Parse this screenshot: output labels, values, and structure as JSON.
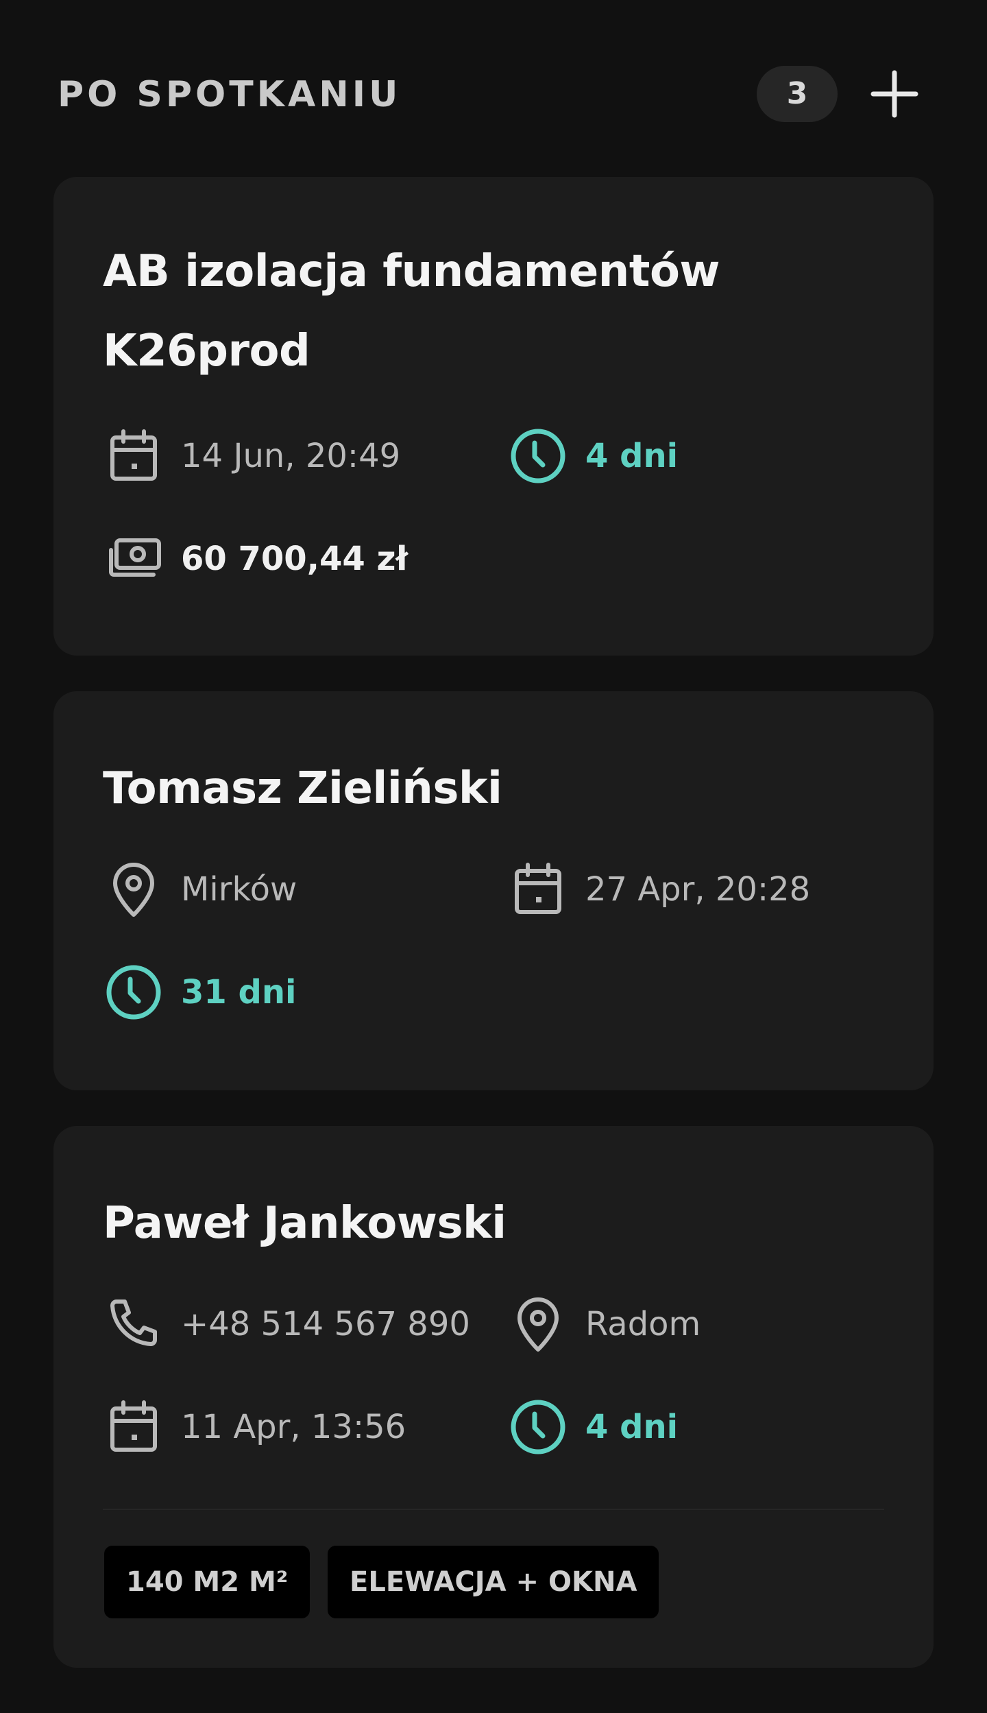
{
  "column": {
    "title": "PO SPOTKANIU",
    "count": "3",
    "add_icon": "plus-icon"
  },
  "colors": {
    "background": "#111111",
    "card": "#1c1c1c",
    "accent": "#5ed1c2",
    "tag_background": "#000000"
  },
  "cards": [
    {
      "title_line1": "AB izolacja fundamentów",
      "title_line2": "K26prod",
      "date": "14 Jun, 20:49",
      "days": "4 dni",
      "amount": "60 700,44 zł",
      "icons": [
        "calendar-icon",
        "clock-icon",
        "money-icon"
      ]
    },
    {
      "title": "Tomasz Zieliński",
      "location": "Mirków",
      "date": "27 Apr, 20:28",
      "days": "31 dni",
      "icons": [
        "location-pin-icon",
        "calendar-icon",
        "clock-icon"
      ]
    },
    {
      "title": "Paweł Jankowski",
      "phone": "+48 514 567 890",
      "location": "Radom",
      "date": "11 Apr, 13:56",
      "days": "4 dni",
      "tags": [
        "140 M2 M²",
        "ELEWACJA + OKNA"
      ],
      "icons": [
        "phone-icon",
        "location-pin-icon",
        "calendar-icon",
        "clock-icon"
      ]
    }
  ]
}
